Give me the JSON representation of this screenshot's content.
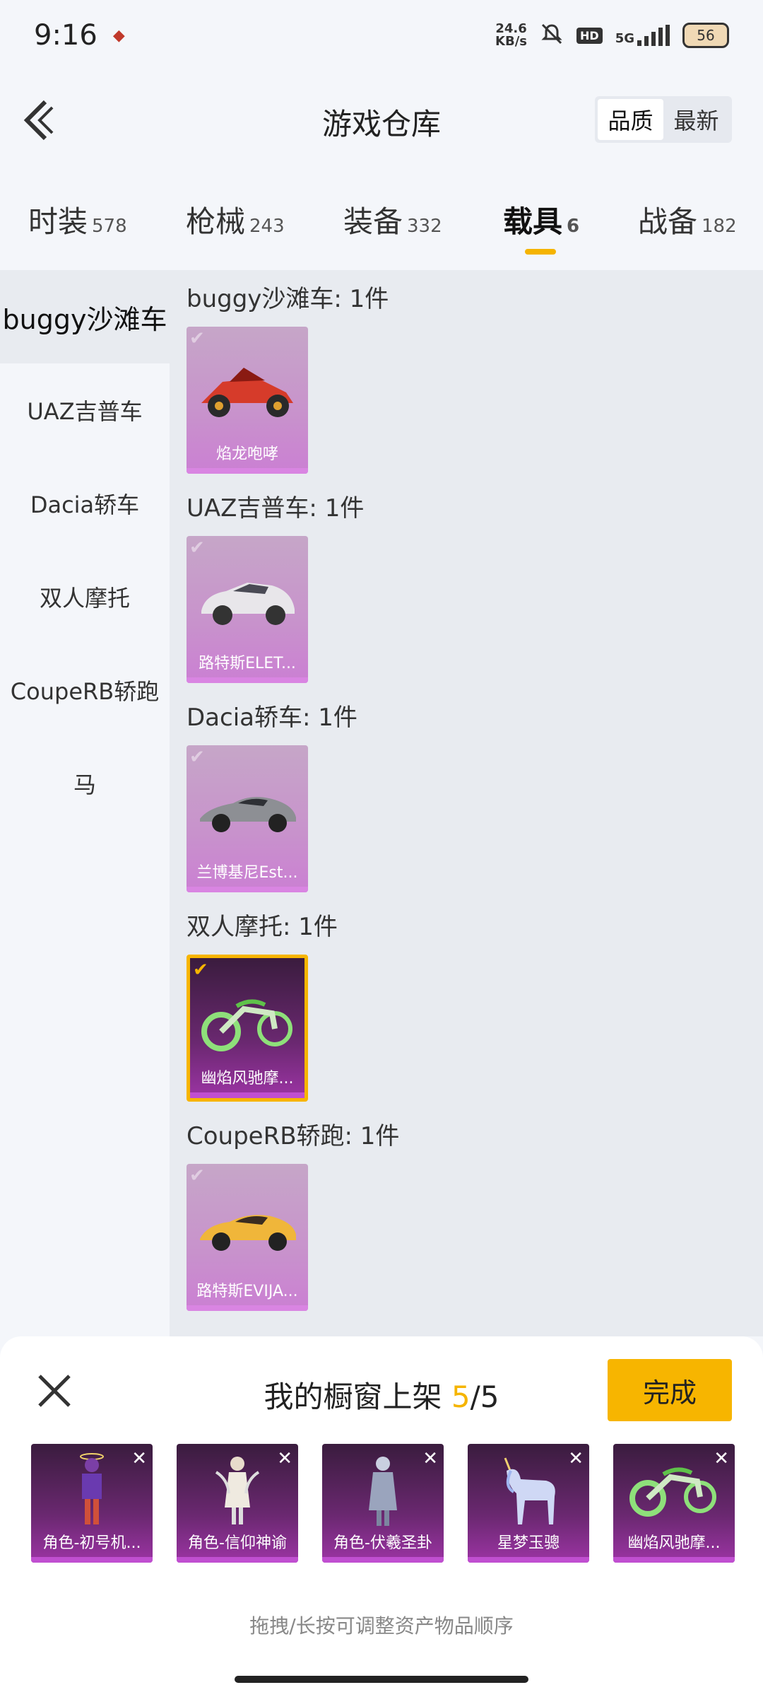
{
  "status_bar": {
    "time": "9:16",
    "speed_value": "24.6",
    "speed_unit": "KB/s",
    "hd": "HD",
    "network": "5G",
    "battery": "56"
  },
  "header": {
    "title": "游戏仓库",
    "sort_options": [
      "品质",
      "最新"
    ],
    "sort_active": "品质"
  },
  "tabs": [
    {
      "label": "时装",
      "count": "578"
    },
    {
      "label": "枪械",
      "count": "243"
    },
    {
      "label": "装备",
      "count": "332"
    },
    {
      "label": "载具",
      "count": "6",
      "active": true
    },
    {
      "label": "战备",
      "count": "182"
    }
  ],
  "side_nav": [
    "buggy沙滩车",
    "UAZ吉普车",
    "Dacia轿车",
    "双人摩托",
    "CoupeRB轿跑",
    "马"
  ],
  "groups": [
    {
      "title": "buggy沙滩车: 1件",
      "item": "焰龙咆哮",
      "icon": "red-buggy-icon",
      "selected": false
    },
    {
      "title": "UAZ吉普车: 1件",
      "item": "路特斯ELET...",
      "icon": "white-suv-icon",
      "selected": false
    },
    {
      "title": "Dacia轿车: 1件",
      "item": "兰博基尼Est...",
      "icon": "grey-sportscar-icon",
      "selected": false
    },
    {
      "title": "双人摩托: 1件",
      "item": "幽焰风驰摩...",
      "icon": "green-motorbike-icon",
      "selected": true
    },
    {
      "title": "CoupeRB轿跑: 1件",
      "item": "路特斯EVIJA...",
      "icon": "yellow-sportscar-icon",
      "selected": false
    }
  ],
  "sheet": {
    "title_prefix": "我的橱窗上架 ",
    "count": "5",
    "total": "/5",
    "done_label": "完成",
    "hint": "拖拽/长按可调整资产物品顺序",
    "slots": [
      {
        "label": "角色-初号机...",
        "icon": "character-robot-icon"
      },
      {
        "label": "角色-信仰神谕",
        "icon": "character-angel-icon"
      },
      {
        "label": "角色-伏羲圣卦",
        "icon": "character-warrior-icon"
      },
      {
        "label": "星梦玉骢",
        "icon": "unicorn-icon"
      },
      {
        "label": "幽焰风驰摩...",
        "icon": "green-motorbike-icon"
      }
    ]
  },
  "colors": {
    "accent": "#f7b500",
    "card_purple": "#cb7fd3",
    "selected_bg": "#6a2870"
  }
}
